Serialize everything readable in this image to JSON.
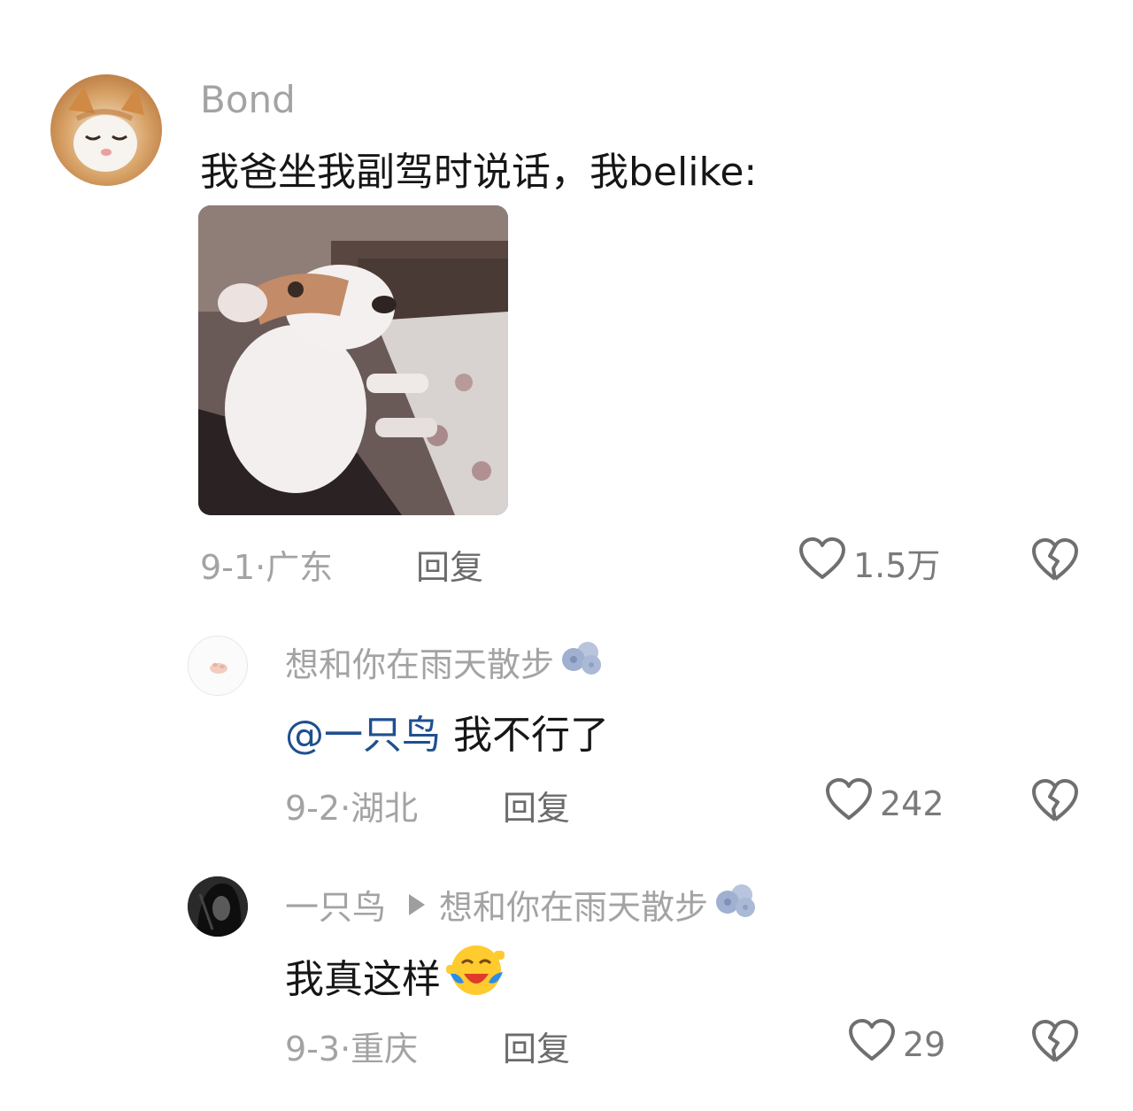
{
  "comments": [
    {
      "author": "Bond",
      "text": "我爸坐我副驾时说话，我belike:",
      "image_desc_icon": "dog-meme-image",
      "date_location": "9-1·广东",
      "reply_label": "回复",
      "likes": "1.5万"
    },
    {
      "author": "想和你在雨天散步",
      "mention": "@一只鸟",
      "text": "我不行了",
      "date_location": "9-2·湖北",
      "reply_label": "回复",
      "likes": "242"
    },
    {
      "author": "一只鸟",
      "reply_to": "想和你在雨天散步",
      "text": "我真这样",
      "date_location": "9-3·重庆",
      "reply_label": "回复",
      "likes": "29"
    }
  ],
  "colors": {
    "mention": "#1f4f8f",
    "muted": "#a3a3a3",
    "text": "#161616"
  }
}
